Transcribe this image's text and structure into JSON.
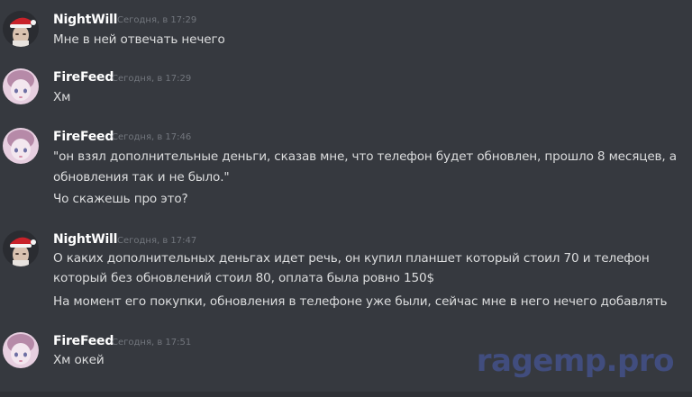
{
  "messages": [
    {
      "author": "NightWill",
      "timestamp": "Сегодня, в 17:29",
      "avatar": "santa-hat-avatar",
      "lines": [
        "Мне в ней отвечать нечего"
      ]
    },
    {
      "author": "FireFeed",
      "timestamp": "Сегодня, в 17:29",
      "avatar": "pink-girl-avatar",
      "lines": [
        "Хм"
      ]
    },
    {
      "author": "FireFeed",
      "timestamp": "Сегодня, в 17:46",
      "avatar": "pink-girl-avatar",
      "lines": [
        "\"он взял дополнительные деньги, сказав мне, что телефон будет обновлен, прошло 8 месяцев, а",
        "обновления так и не было.\"",
        "Чо скажешь про это?"
      ]
    },
    {
      "author": "NightWill",
      "timestamp": "Сегодня, в 17:47",
      "avatar": "santa-hat-avatar",
      "lines": [
        "О каких дополнительных деньгах идет речь, он купил планшет который стоил 70 и телефон",
        "который без обновлений стоил 80, оплата была ровно 150$",
        "На момент его покупки, обновления в телефоне уже были, сейчас мне в него нечего добавлять"
      ]
    },
    {
      "author": "FireFeed",
      "timestamp": "Сегодня, в 17:51",
      "avatar": "pink-girl-avatar",
      "lines": [
        "Хм окей"
      ]
    }
  ],
  "watermark": "ragemp.pro",
  "colors": {
    "background": "#36393f",
    "author": "#ffffff",
    "timestamp": "#72767d",
    "text": "#dcddde",
    "watermark": "#414d7e"
  }
}
